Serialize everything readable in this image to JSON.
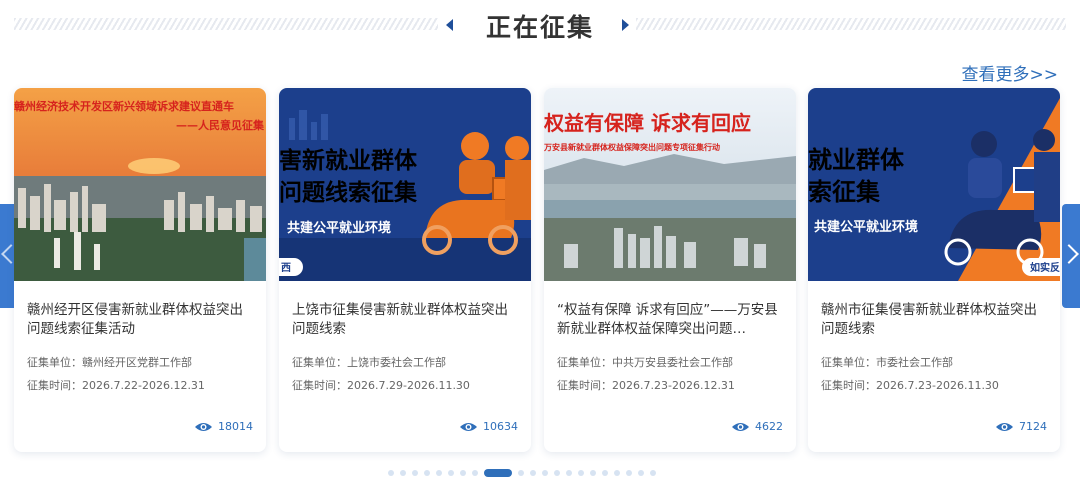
{
  "section": {
    "title": "正在征集",
    "more_label": "查看更多>>"
  },
  "labels": {
    "unit_prefix": "征集单位：",
    "time_prefix": "征集时间："
  },
  "colors": {
    "accent": "#2f6fba",
    "nav": "#3b7ad0",
    "card_bg": "#ffffff",
    "poster_blue": "#1c3f8c",
    "poster_orange": "#f07a24"
  },
  "cards": [
    {
      "title": "赣州经开区侵害新就业群体权益突出问题线索征集活动",
      "unit": "赣州经开区党群工作部",
      "time": "2026.7.22-2026.12.31",
      "views": "18014",
      "image": {
        "caption1": "赣州经济技术开发区新兴领域诉求建议直通车",
        "caption2": "——人民意见征集"
      }
    },
    {
      "title": "上饶市征集侵害新就业群体权益突出问题线索",
      "unit": "上饶市委社会工作部",
      "time": "2026.7.29-2026.11.30",
      "views": "10634",
      "image": {
        "line1": "害新就业群体",
        "line2": "问题线索征集",
        "line3": "共建公平就业环境",
        "badge": "西"
      }
    },
    {
      "title": "“权益有保障 诉求有回应”——万安县新就业群体权益保障突出问题…",
      "unit": "中共万安县委社会工作部",
      "time": "2026.7.23-2026.12.31",
      "views": "4622",
      "image": {
        "caption1": "权益有保障 诉求有回应",
        "caption2": "万安县新就业群体权益保障突出问题专项征集行动"
      }
    },
    {
      "title": "赣州市征集侵害新就业群体权益突出问题线索",
      "unit": "市委社会工作部",
      "time": "2026.7.23-2026.11.30",
      "views": "7124",
      "image": {
        "line1": "就业群体",
        "line2": "索征集",
        "line3": "共建公平就业环境",
        "badge": "如实反"
      }
    }
  ],
  "pagination": {
    "total": 21,
    "active": 8
  },
  "icons": {
    "prev": "chevron-left-icon",
    "next": "chevron-right-icon",
    "views": "eye-icon"
  }
}
